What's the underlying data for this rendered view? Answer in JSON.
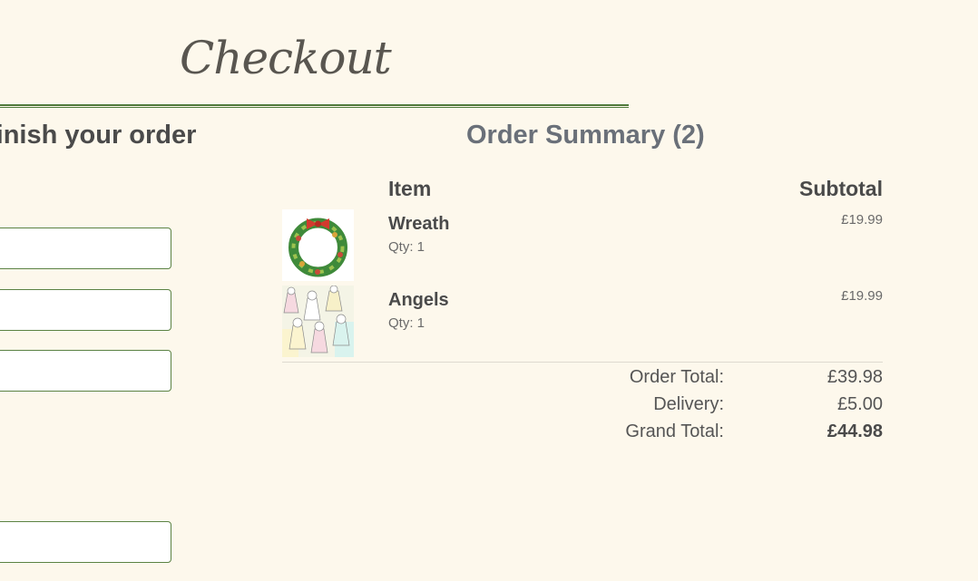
{
  "page": {
    "title": "Checkout"
  },
  "form": {
    "heading": "finish your order"
  },
  "summary": {
    "heading": "Order Summary (2)",
    "columns": {
      "item": "Item",
      "subtotal": "Subtotal"
    },
    "items": [
      {
        "name": "Wreath",
        "qty": "Qty: 1",
        "price": "£19.99",
        "image": "wreath-thumbnail"
      },
      {
        "name": "Angels",
        "qty": "Qty: 1",
        "price": "£19.99",
        "image": "angels-thumbnail"
      }
    ],
    "totals": {
      "order_label": "Order Total:",
      "order_value": "£39.98",
      "delivery_label": "Delivery:",
      "delivery_value": "£5.00",
      "grand_label": "Grand Total:",
      "grand_value": "£44.98"
    }
  },
  "colors": {
    "background": "#fdf8ec",
    "accent_green": "#4f7a3b",
    "summary_heading": "#6a7079"
  }
}
